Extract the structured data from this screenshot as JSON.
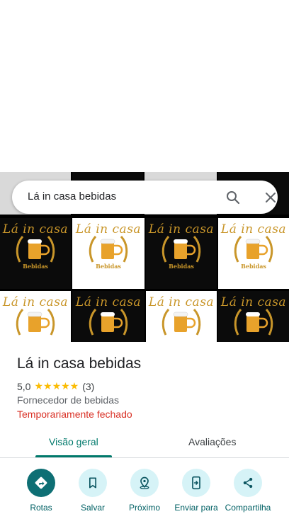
{
  "search": {
    "query": "Lá in casa bebidas"
  },
  "mosaic": {
    "brand_text": "Lá in casa",
    "subtitle": "Bebidas"
  },
  "place": {
    "name": "Lá in casa bebidas",
    "rating": "5,0",
    "stars": "★★★★★",
    "review_count": "(3)",
    "category": "Fornecedor de bebidas",
    "status": "Temporariamente fechado"
  },
  "tabs": [
    {
      "label": "Visão geral",
      "active": true
    },
    {
      "label": "Avaliações",
      "active": false
    }
  ],
  "actions": [
    {
      "label": "Rotas",
      "icon": "directions-icon"
    },
    {
      "label": "Salvar",
      "icon": "bookmark-icon"
    },
    {
      "label": "Próximo",
      "icon": "nearby-icon"
    },
    {
      "label": "Enviar para",
      "icon": "send-to-device-icon"
    },
    {
      "label": "Compartilha",
      "icon": "share-icon"
    }
  ],
  "colors": {
    "accent": "#00796b",
    "primary_button": "#0e6f74",
    "secondary_button": "#d6f3f7",
    "closed_status": "#d93025",
    "stars": "#fbbc04",
    "brand_gold": "#c9962a"
  }
}
